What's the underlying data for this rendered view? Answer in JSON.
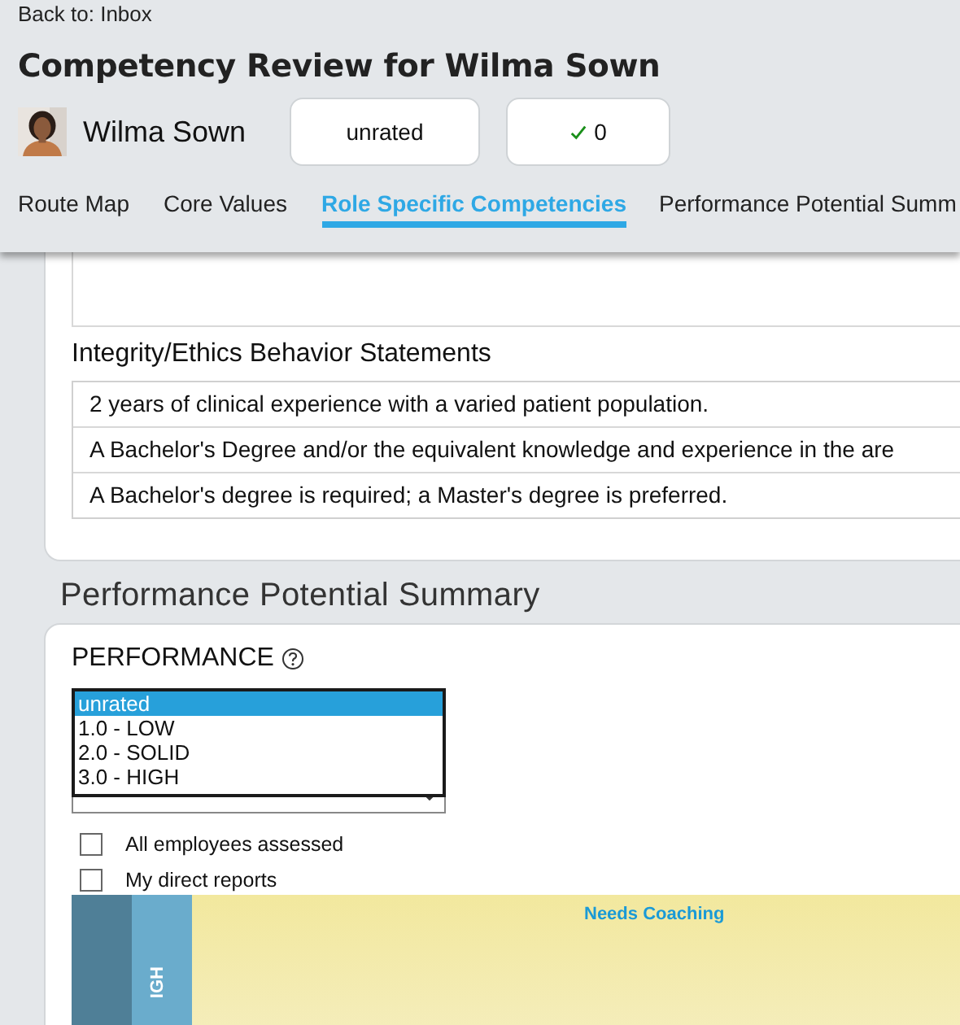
{
  "back_link": "Back to: Inbox",
  "title": "Competency Review for Wilma Sown",
  "employee": {
    "name": "Wilma Sown"
  },
  "status_buttons": [
    {
      "kind": "text",
      "label": "unrated"
    },
    {
      "kind": "check",
      "label": "0"
    }
  ],
  "tabs": [
    {
      "label": "Route Map",
      "selected": false
    },
    {
      "label": "Core Values",
      "selected": false
    },
    {
      "label": "Role Specific Competencies",
      "selected": true
    },
    {
      "label": "Performance Potential Summ",
      "selected": false
    }
  ],
  "behavior_section": {
    "heading": "Integrity/Ethics Behavior Statements",
    "statements": [
      "2 years of clinical experience with a varied patient population.",
      "A Bachelor's Degree and/or the equivalent knowledge and experience in the are",
      "A Bachelor's degree is required; a Master's degree is preferred."
    ]
  },
  "summary": {
    "heading": "Performance Potential Summary",
    "performance_label": "PERFORMANCE",
    "select": {
      "options": [
        {
          "label": "unrated",
          "selected": true
        },
        {
          "label": "1.0 - LOW",
          "selected": false
        },
        {
          "label": "2.0 - SOLID",
          "selected": false
        },
        {
          "label": "3.0 - HIGH",
          "selected": false
        }
      ]
    },
    "filters": [
      {
        "label": "All employees assessed",
        "checked": false
      },
      {
        "label": "My direct reports",
        "checked": false
      }
    ],
    "grid": {
      "row_label": "IGH",
      "cell_label": "Needs Coaching"
    }
  }
}
